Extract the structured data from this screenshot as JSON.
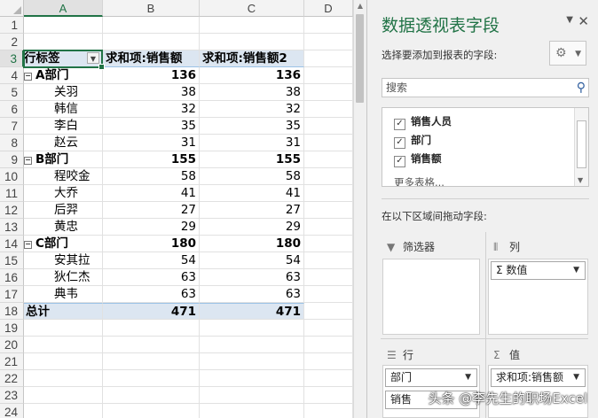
{
  "columns": [
    "A",
    "B",
    "C",
    "D"
  ],
  "pivot_header": {
    "row_label": "行标签",
    "col1": "求和项:销售额",
    "col2": "求和项:销售额2"
  },
  "rows": [
    {
      "n": "1"
    },
    {
      "n": "2"
    },
    {
      "n": "3",
      "type": "header"
    },
    {
      "n": "4",
      "type": "group",
      "label": "A部门",
      "v1": "136",
      "v2": "136"
    },
    {
      "n": "5",
      "type": "item",
      "label": "关羽",
      "v1": "38",
      "v2": "38"
    },
    {
      "n": "6",
      "type": "item",
      "label": "韩信",
      "v1": "32",
      "v2": "32"
    },
    {
      "n": "7",
      "type": "item",
      "label": "李白",
      "v1": "35",
      "v2": "35"
    },
    {
      "n": "8",
      "type": "item",
      "label": "赵云",
      "v1": "31",
      "v2": "31"
    },
    {
      "n": "9",
      "type": "group",
      "label": "B部门",
      "v1": "155",
      "v2": "155"
    },
    {
      "n": "10",
      "type": "item",
      "label": "程咬金",
      "v1": "58",
      "v2": "58"
    },
    {
      "n": "11",
      "type": "item",
      "label": "大乔",
      "v1": "41",
      "v2": "41"
    },
    {
      "n": "12",
      "type": "item",
      "label": "后羿",
      "v1": "27",
      "v2": "27"
    },
    {
      "n": "13",
      "type": "item",
      "label": "黄忠",
      "v1": "29",
      "v2": "29"
    },
    {
      "n": "14",
      "type": "group",
      "label": "C部门",
      "v1": "180",
      "v2": "180"
    },
    {
      "n": "15",
      "type": "item",
      "label": "安其拉",
      "v1": "54",
      "v2": "54"
    },
    {
      "n": "16",
      "type": "item",
      "label": "狄仁杰",
      "v1": "63",
      "v2": "63"
    },
    {
      "n": "17",
      "type": "item",
      "label": "典韦",
      "v1": "63",
      "v2": "63"
    },
    {
      "n": "18",
      "type": "total",
      "label": "总计",
      "v1": "471",
      "v2": "471"
    },
    {
      "n": "19"
    },
    {
      "n": "20"
    },
    {
      "n": "21"
    },
    {
      "n": "22"
    },
    {
      "n": "23"
    },
    {
      "n": "24"
    }
  ],
  "pane": {
    "title": "数据透视表字段",
    "subtitle": "选择要添加到报表的字段:",
    "search_placeholder": "搜索",
    "fields": [
      {
        "label": "销售人员",
        "checked": true
      },
      {
        "label": "部门",
        "checked": true
      },
      {
        "label": "销售额",
        "checked": true
      }
    ],
    "more_tables": "更多表格...",
    "drag_hint": "在以下区域间拖动字段:",
    "areas": {
      "filters": "筛选器",
      "columns": "列",
      "rows": "行",
      "values": "值"
    },
    "column_chip": "Σ 数值",
    "row_chips": [
      "部门",
      "销售"
    ],
    "value_chips": [
      "求和项:销售额"
    ]
  },
  "watermark": "头条 @李先生的职场Excel"
}
